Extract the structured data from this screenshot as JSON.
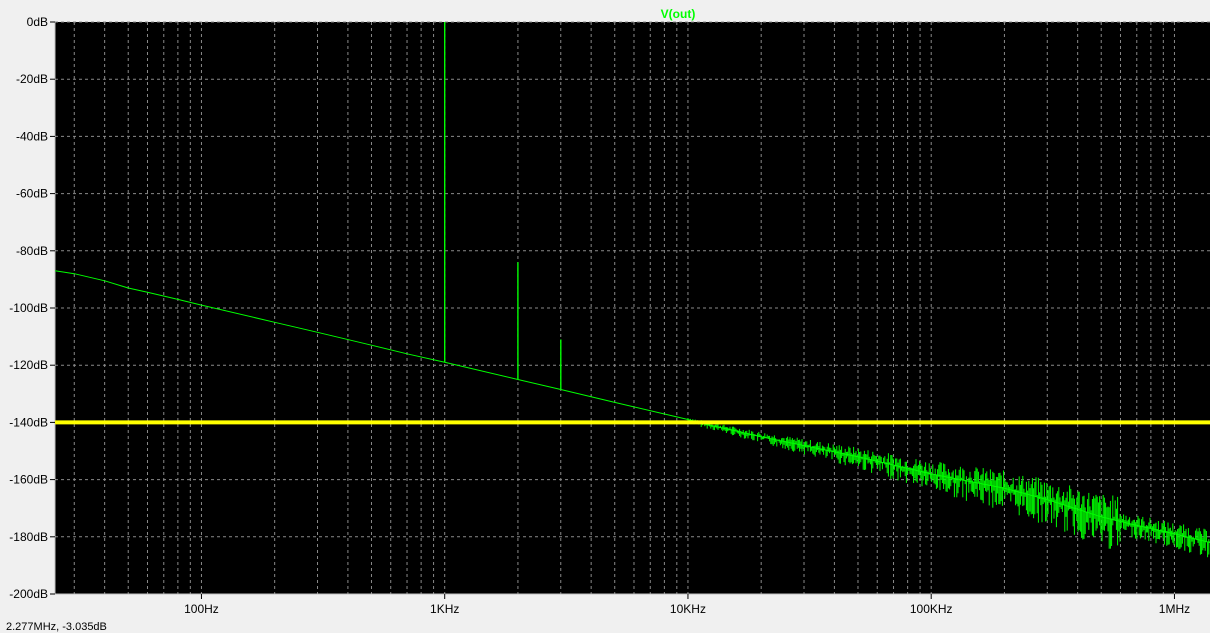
{
  "chart_data": {
    "type": "line",
    "title": "V(out)",
    "xlabel": "",
    "ylabel": "",
    "xscale": "log",
    "xlim": [
      25,
      1400000
    ],
    "ylim": [
      -200,
      0
    ],
    "y_ticks": [
      0,
      -20,
      -40,
      -60,
      -80,
      -100,
      -120,
      -140,
      -160,
      -180,
      -200
    ],
    "y_tick_labels": [
      "0dB",
      "-20dB",
      "-40dB",
      "-60dB",
      "-80dB",
      "-100dB",
      "-120dB",
      "-140dB",
      "-160dB",
      "-180dB",
      "-200dB"
    ],
    "x_ticks": [
      100,
      1000,
      10000,
      100000,
      1000000
    ],
    "x_tick_labels": [
      "100Hz",
      "1KHz",
      "10KHz",
      "100KHz",
      "1MHz"
    ],
    "grid": true,
    "background": "#000000",
    "series": [
      {
        "name": "V(out)",
        "color": "#00ff00",
        "x": [
          25,
          30,
          40,
          50,
          60,
          80,
          100,
          200,
          300,
          500,
          700,
          1000,
          2000,
          3000,
          5000,
          10000,
          11000,
          20000,
          50000,
          100000,
          200000,
          300000,
          500000,
          700000,
          1000000,
          1400000
        ],
        "y": [
          -87,
          -88,
          -90.5,
          -93,
          -94.5,
          -97,
          -99,
          -105,
          -108.5,
          -113,
          -116,
          -119,
          -125,
          -128.5,
          -133,
          -139,
          -140,
          -145,
          -152,
          -158,
          -163,
          -167,
          -173,
          -176,
          -179,
          -182
        ],
        "spikes": [
          {
            "x": 1000,
            "y": 0
          },
          {
            "x": 2000,
            "y": -84
          },
          {
            "x": 3000,
            "y": -111
          }
        ]
      }
    ],
    "cursor": {
      "label": "-140dB",
      "y": -140,
      "color": "#ffff00"
    }
  },
  "status_text": "2.277MHz, -3.035dB"
}
